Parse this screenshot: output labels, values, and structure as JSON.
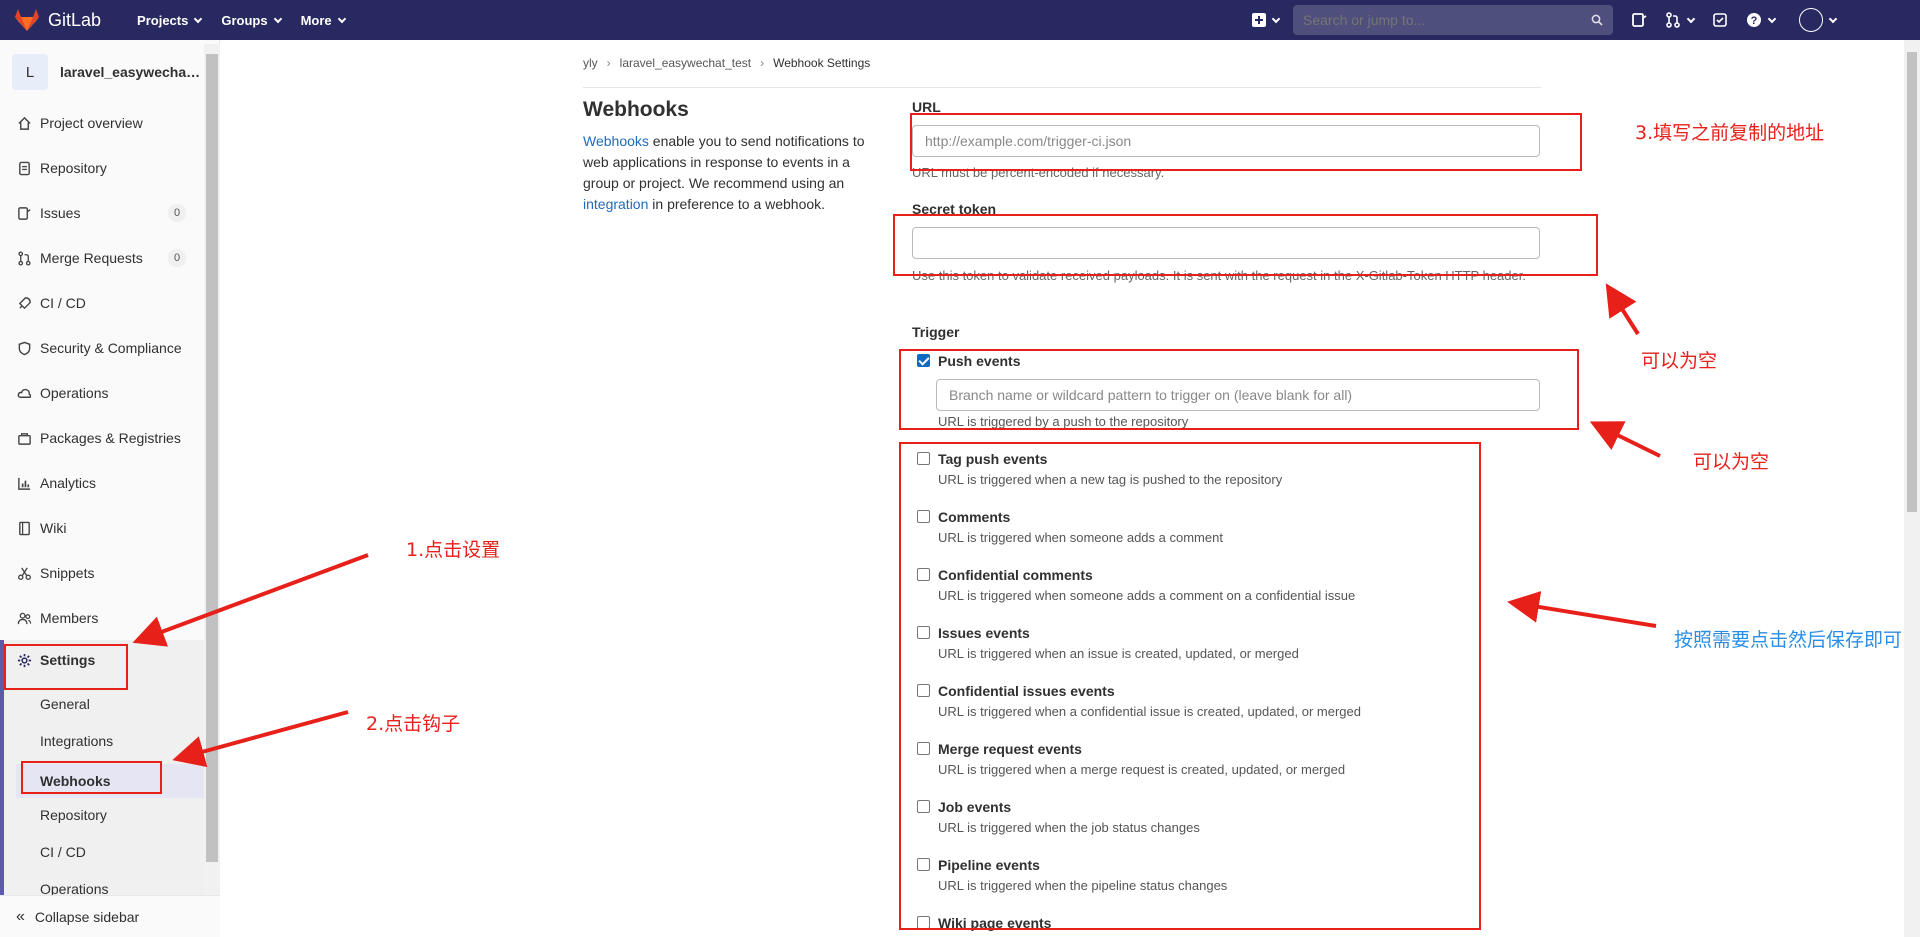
{
  "topbar": {
    "brand": "GitLab",
    "nav": [
      "Projects",
      "Groups",
      "More"
    ],
    "search_placeholder": "Search or jump to..."
  },
  "sidebar": {
    "project_initial": "L",
    "project_name": "laravel_easywechat_test",
    "items": [
      {
        "label": "Project overview",
        "icon": "home-icon"
      },
      {
        "label": "Repository",
        "icon": "doc-icon"
      },
      {
        "label": "Issues",
        "icon": "issues-icon",
        "badge": "0"
      },
      {
        "label": "Merge Requests",
        "icon": "merge-icon",
        "badge": "0"
      },
      {
        "label": "CI / CD",
        "icon": "rocket-icon"
      },
      {
        "label": "Security & Compliance",
        "icon": "shield-icon"
      },
      {
        "label": "Operations",
        "icon": "cloud-icon"
      },
      {
        "label": "Packages & Registries",
        "icon": "package-icon"
      },
      {
        "label": "Analytics",
        "icon": "chart-icon"
      },
      {
        "label": "Wiki",
        "icon": "book-icon"
      },
      {
        "label": "Snippets",
        "icon": "scissors-icon"
      },
      {
        "label": "Members",
        "icon": "users-icon"
      },
      {
        "label": "Settings",
        "icon": "gear-icon"
      }
    ],
    "settings_sub": [
      "General",
      "Integrations",
      "Webhooks",
      "Repository",
      "CI / CD",
      "Operations"
    ],
    "collapse": "Collapse sidebar"
  },
  "breadcrumb": [
    "yly",
    "laravel_easywechat_test",
    "Webhook Settings"
  ],
  "main": {
    "title": "Webhooks",
    "intro_link": "Webhooks",
    "intro_text": " enable you to send notifications to web applications in response to events in a group or project. We recommend using an ",
    "intro_link2": "integration",
    "intro_text2": " in preference to a webhook.",
    "url_label": "URL",
    "url_placeholder": "http://example.com/trigger-ci.json",
    "url_help": "URL must be percent-encoded if necessary.",
    "token_label": "Secret token",
    "token_help": "Use this token to validate received payloads. It is sent with the request in the X-Gitlab-Token HTTP header.",
    "trigger_label": "Trigger",
    "push_title": "Push events",
    "push_placeholder": "Branch name or wildcard pattern to trigger on (leave blank for all)",
    "push_desc": "URL is triggered by a push to the repository",
    "events": [
      {
        "title": "Tag push events",
        "desc": "URL is triggered when a new tag is pushed to the repository"
      },
      {
        "title": "Comments",
        "desc": "URL is triggered when someone adds a comment"
      },
      {
        "title": "Confidential comments",
        "desc": "URL is triggered when someone adds a comment on a confidential issue"
      },
      {
        "title": "Issues events",
        "desc": "URL is triggered when an issue is created, updated, or merged"
      },
      {
        "title": "Confidential issues events",
        "desc": "URL is triggered when a confidential issue is created, updated, or merged"
      },
      {
        "title": "Merge request events",
        "desc": "URL is triggered when a merge request is created, updated, or merged"
      },
      {
        "title": "Job events",
        "desc": "URL is triggered when the job status changes"
      },
      {
        "title": "Pipeline events",
        "desc": "URL is triggered when the pipeline status changes"
      },
      {
        "title": "Wiki page events",
        "desc": ""
      }
    ]
  },
  "annotations": {
    "step1": "1.点击设置",
    "step2": "2.点击钩子",
    "step3": "3.填写之前复制的地址",
    "can_empty_1": "可以为空",
    "can_empty_2": "可以为空",
    "select_save": "按照需要点击然后保存即可",
    "color_red": "#e8201a",
    "color_blue": "#2b8ee6"
  }
}
